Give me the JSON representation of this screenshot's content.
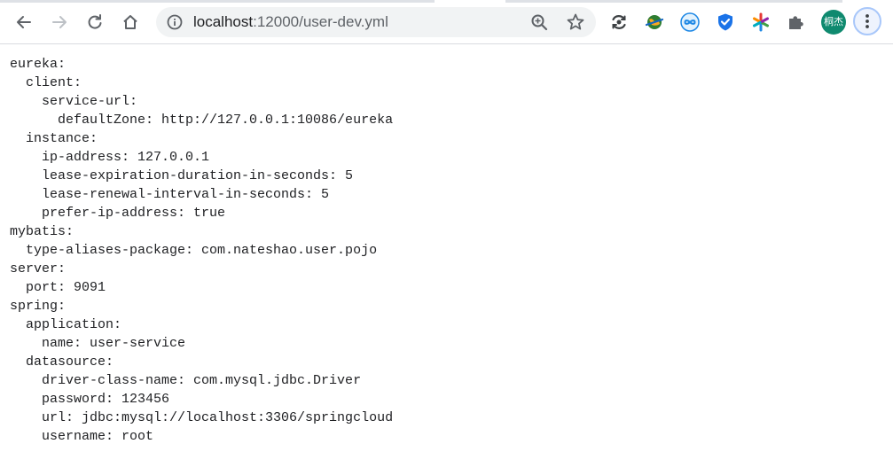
{
  "browser": {
    "url_host": "localhost",
    "url_rest": ":12000/user-dev.yml",
    "profile_initials": "桐杰",
    "accent_color": "#a8c7fa",
    "avatar_color": "#0f8a6f",
    "icons": {
      "back": "arrow-left-icon",
      "forward": "arrow-right-icon",
      "reload": "reload-icon",
      "home": "home-icon",
      "site_info": "info-icon",
      "zoom": "zoom-in-icon",
      "bookmark": "star-icon",
      "extensions": [
        "sync-extension-icon",
        "globe-extension-icon",
        "infinity-extension-icon",
        "shield-extension-icon",
        "asterisk-extension-icon",
        "puzzle-icon"
      ],
      "menu": "kebab-menu-icon"
    }
  },
  "document": {
    "lines": [
      "eureka:",
      "  client:",
      "    service-url:",
      "      defaultZone: http://127.0.0.1:10086/eureka",
      "  instance:",
      "    ip-address: 127.0.0.1",
      "    lease-expiration-duration-in-seconds: 5",
      "    lease-renewal-interval-in-seconds: 5",
      "    prefer-ip-address: true",
      "mybatis:",
      "  type-aliases-package: com.nateshao.user.pojo",
      "server:",
      "  port: 9091",
      "spring:",
      "  application:",
      "    name: user-service",
      "  datasource:",
      "    driver-class-name: com.mysql.jdbc.Driver",
      "    password: 123456",
      "    url: jdbc:mysql://localhost:3306/springcloud",
      "    username: root"
    ]
  }
}
